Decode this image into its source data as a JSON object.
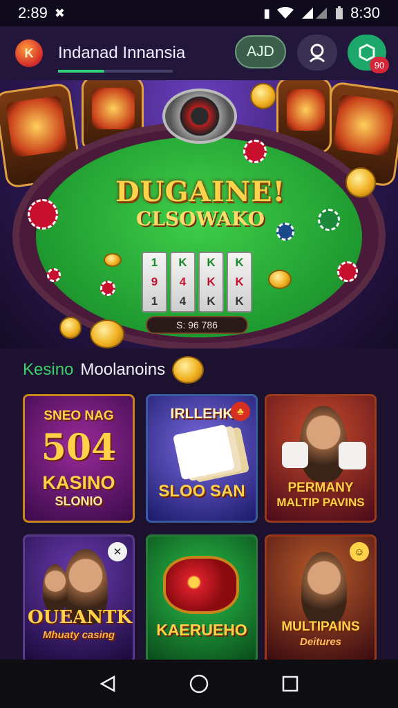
{
  "status_bar": {
    "time": "2:89",
    "right_time": "8:30",
    "icons": [
      "shuffle-icon",
      "vibrate-icon",
      "wifi-icon",
      "signal-icon",
      "battery-icon"
    ]
  },
  "app_bar": {
    "logo_text": "K",
    "title": "Indanad Innansia",
    "aid_label": "AJD",
    "search_icon": "search-user-icon",
    "gift_icon": "hexagon-icon",
    "badge_count": "90"
  },
  "hero": {
    "title": "DUGAINE!",
    "subtitle": "CLSOWAKO",
    "reels": [
      [
        "1",
        "9",
        "1"
      ],
      [
        "K",
        "4",
        "4"
      ],
      [
        "K",
        "K",
        "K"
      ],
      [
        "K",
        "K",
        "K"
      ]
    ],
    "counter": "S: 96 786"
  },
  "section": {
    "title_green": "Kesino",
    "title_white": "Moolanoins"
  },
  "cards": [
    {
      "top": "SNEO NAG",
      "big": "504",
      "mid": "KASINO",
      "sub": "SLONIO"
    },
    {
      "top": "IRLLEHK",
      "mid": "SLOO SAN"
    },
    {
      "top": "PERMANY",
      "mid": "MALTIP PAVINS"
    },
    {
      "mid": "OUEANTK",
      "sub": "Mhuaty casing"
    },
    {
      "mid": "KAERUEHO"
    },
    {
      "mid": "MULTIPAINS",
      "sub": "Deitures"
    }
  ],
  "colors": {
    "accent_green": "#1ca86a",
    "gold": "#ffd24a",
    "badge_red": "#d6273a"
  }
}
